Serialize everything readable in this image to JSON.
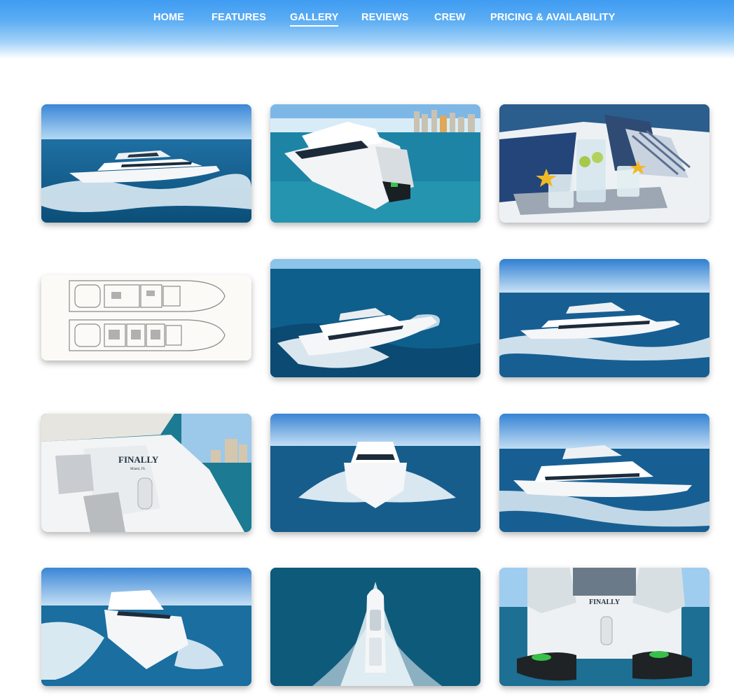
{
  "nav": {
    "home": "HOME",
    "features": "FEATURES",
    "gallery": "GALLERY",
    "reviews": "REVIEWS",
    "crew": "CREW",
    "pricing": "PRICING & AVAILABILITY",
    "active": "GALLERY"
  },
  "gallery": {
    "boat_name": "FINALLY",
    "boat_home_port": "Miami, FL",
    "photos": [
      "yacht-cruising-side-view",
      "yacht-stern-with-city-skyline",
      "deck-drinks-with-pillows",
      "deck-plan-drawing",
      "yacht-aerial-bow-view",
      "yacht-cruising-profile",
      "stern-deck-finally",
      "yacht-head-on-aerial",
      "yacht-cruising-side-profile",
      "yacht-bow-wave-close",
      "yacht-overhead-wake",
      "stern-with-jet-skis"
    ]
  },
  "colors": {
    "nav_gradient_top": "#3f9cf2",
    "sea": "#0d5c86",
    "sky": "#5aa6e6",
    "hull": "#ffffff"
  }
}
